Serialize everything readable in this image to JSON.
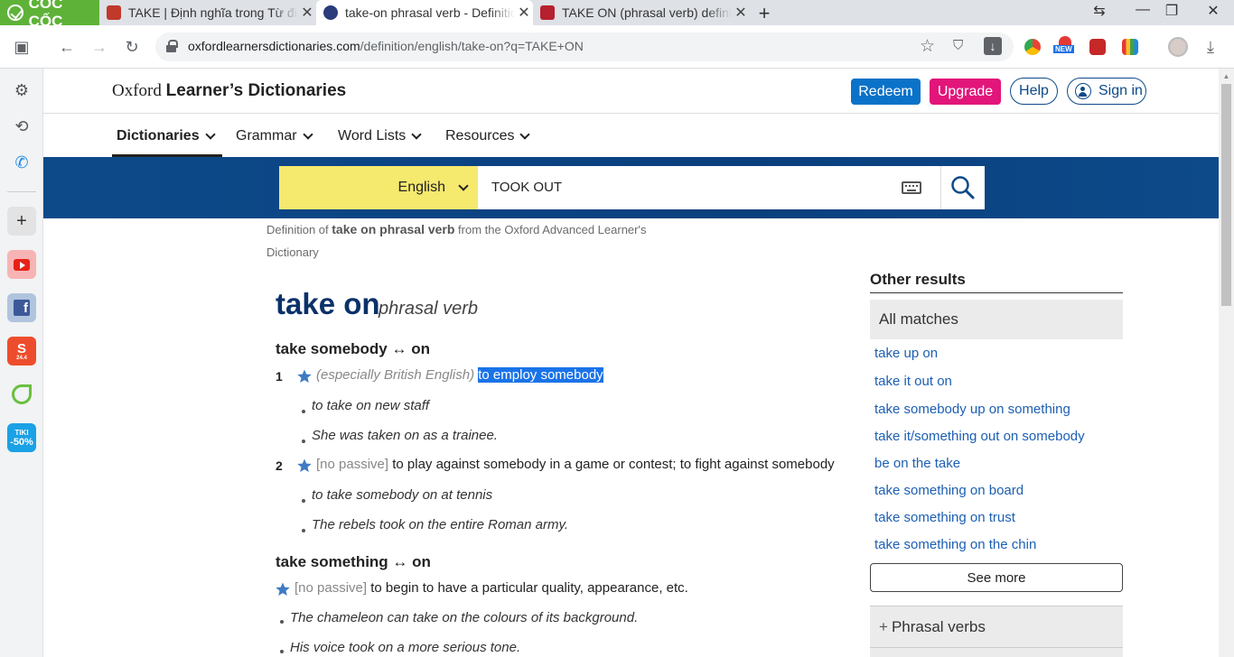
{
  "browser": {
    "brand": "CỐC CỐC",
    "tabs": [
      {
        "title": "TAKE | Định nghĩa trong Từ điển",
        "fav_color": "#c0392b"
      },
      {
        "title": "take-on phrasal verb - Definition",
        "fav_color": "#2a3c7a"
      },
      {
        "title": "TAKE ON (phrasal verb) definition",
        "fav_color": "#b7202e"
      }
    ],
    "url_host": "oxfordlearnersdictionaries.com",
    "url_path": "/definition/english/take-on?q=TAKE+ON",
    "ext_new_label": "NEW"
  },
  "sidebar": {
    "shopee_badge": "24.4",
    "tiki_label": "TIKI",
    "tiki_discount": "-50%"
  },
  "site": {
    "title_serif": "Oxford",
    "title_bold": "Learner’s Dictionaries",
    "redeem": "Redeem",
    "upgrade": "Upgrade",
    "help": "Help",
    "signin": "Sign in",
    "nav": [
      "Dictionaries",
      "Grammar",
      "Word Lists",
      "Resources"
    ]
  },
  "search": {
    "language": "English",
    "query": "TOOK OUT"
  },
  "entry": {
    "defof_prefix": "Definition of ",
    "defof_term": "take on phrasal verb",
    "defof_suffix": " from the Oxford Advanced Learner's Dictionary",
    "headword": "take on",
    "pos": "phrasal verb",
    "pv1": "take somebody ↔ on",
    "s1_num": "1",
    "s1_label": "(especially British English)",
    "s1_def": "to employ somebody",
    "s1_ex1": "to take on new staff",
    "s1_ex2": "She was taken on as a trainee.",
    "s2_num": "2",
    "s2_gram": "[no passive]",
    "s2_def": "to play against somebody in a game or contest; to fight against somebody",
    "s2_ex1": "to take somebody on at tennis",
    "s2_ex2": "The rebels took on the entire Roman army.",
    "pv2": "take something ↔ on",
    "s3_gram": "[no passive]",
    "s3_def": "to begin to have a particular quality, appearance, etc.",
    "s3_ex1": "The chameleon can take on the colours of its background.",
    "s3_ex2": "His voice took on a more serious tone."
  },
  "other_results": {
    "title": "Other results",
    "all_matches": "All matches",
    "links": [
      "take up on",
      "take it out on",
      "take somebody up on something",
      "take it/something out on somebody",
      "be on the take",
      "take something on board",
      "take something on trust",
      "take something on the chin"
    ],
    "see_more": "See more",
    "phrasal_verbs": "Phrasal verbs"
  },
  "colors": {
    "oxford_blue": "#0d4a8a",
    "redeem": "#0b72c9",
    "upgrade": "#e2157a",
    "lang_yellow": "#f5e96e",
    "link": "#1c5fb3"
  }
}
